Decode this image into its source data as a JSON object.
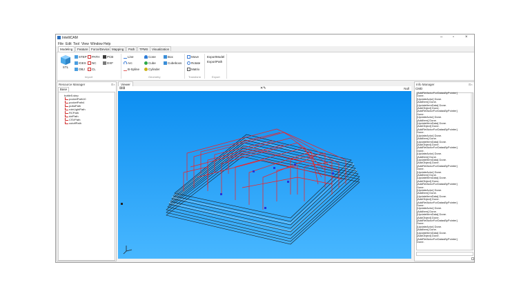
{
  "window": {
    "title": "IntelliCAM"
  },
  "menu": [
    "File",
    "Edit",
    "Tool",
    "View",
    "Window",
    "Help"
  ],
  "tabs": [
    "Modeling",
    "Feature",
    "Force/Device",
    "Mapping",
    "Path",
    "TPMS",
    "Visualization"
  ],
  "ribbon": {
    "stl": "STL",
    "import_items": [
      "STEP",
      "IGES",
      "OBJ"
    ],
    "path_items": [
      "PATH",
      "NC",
      "CL"
    ],
    "pcb_items": [
      "PCB",
      "DXF"
    ],
    "import_label": "Import",
    "geometry_items": [
      "Line",
      "Arc",
      "B-Spline",
      "Cone",
      "Cube",
      "Cylinder",
      "Box",
      "Cubeboxs"
    ],
    "geometry_label": "Geometry",
    "transform_items": [
      "Move",
      "Rotate",
      "Matrix"
    ],
    "transform_label": "Transform",
    "export_items": [
      "ExportModel",
      "ExportPath"
    ],
    "export_label": "Export"
  },
  "resource_manager": {
    "title": "Resource Manager",
    "tab": "Base",
    "root": "bottle5.step",
    "items": [
      "pocketPath10",
      "pocketPath4",
      "puttaPath",
      "roleLightPath",
      "RCPath",
      "dxfPath",
      "CSVPath",
      "cutoffPath"
    ]
  },
  "viewer": {
    "tab": "Viewer",
    "right_label": "Null"
  },
  "info_manager": {
    "title": "Info Manager",
    "tab": "CMD",
    "log": [
      "[AddRefActorForDatasByPointer]",
      "Done.",
      "[UpdateActor] Done.",
      "[AddItem] Done.",
      "[UpdateItemData] Done.",
      "[AddObject] Done.",
      "[AddRefActorForDatasByPointer]",
      "Done.",
      "[UpdateActor] Done.",
      "[AddItem] Done.",
      "[UpdateItemData] Done.",
      "[AddObject] Done.",
      "[AddRefActorForDatasByPointer]",
      "Done.",
      "[UpdateActor] Done.",
      "[AddItem] Done.",
      "[UpdateItemData] Done.",
      "[AddObject] Done.",
      "[AddRefActorForDatasByPointer]",
      "Done.",
      "[UpdateActor] Done.",
      "[AddItem] Done.",
      "[UpdateItemData] Done.",
      "[AddObject] Done.",
      "[AddRefActorForDatasByPointer]",
      "Done.",
      "[UpdateActor] Done.",
      "[AddItem] Done.",
      "[UpdateItemData] Done.",
      "[AddObject] Done.",
      "[AddRefActorForDatasByPointer]",
      "Done.",
      "[UpdateActor] Done.",
      "[AddItem] Done.",
      "[UpdateItemData] Done.",
      "[AddObject] Done.",
      "[AddRefActorForDatasByPointer]",
      "Done.",
      "[UpdateActor] Done.",
      "[AddItem] Done.",
      "[UpdateItemData] Done.",
      "[AddObject] Done.",
      "[AddRefActorForDatasByPointer]",
      "Done.",
      "[UpdateActor] Done.",
      "[AddItem] Done.",
      "[UpdateItemData] Done.",
      "[AddObject] Done.",
      "[AddRefActorForDatasByPointer]",
      "Done."
    ]
  },
  "colors": {
    "viewer_top": "#0a8df0",
    "viewer_bottom": "#48b7ff",
    "toolpath": "#ff1a1a",
    "model": "#1a1a1a"
  }
}
